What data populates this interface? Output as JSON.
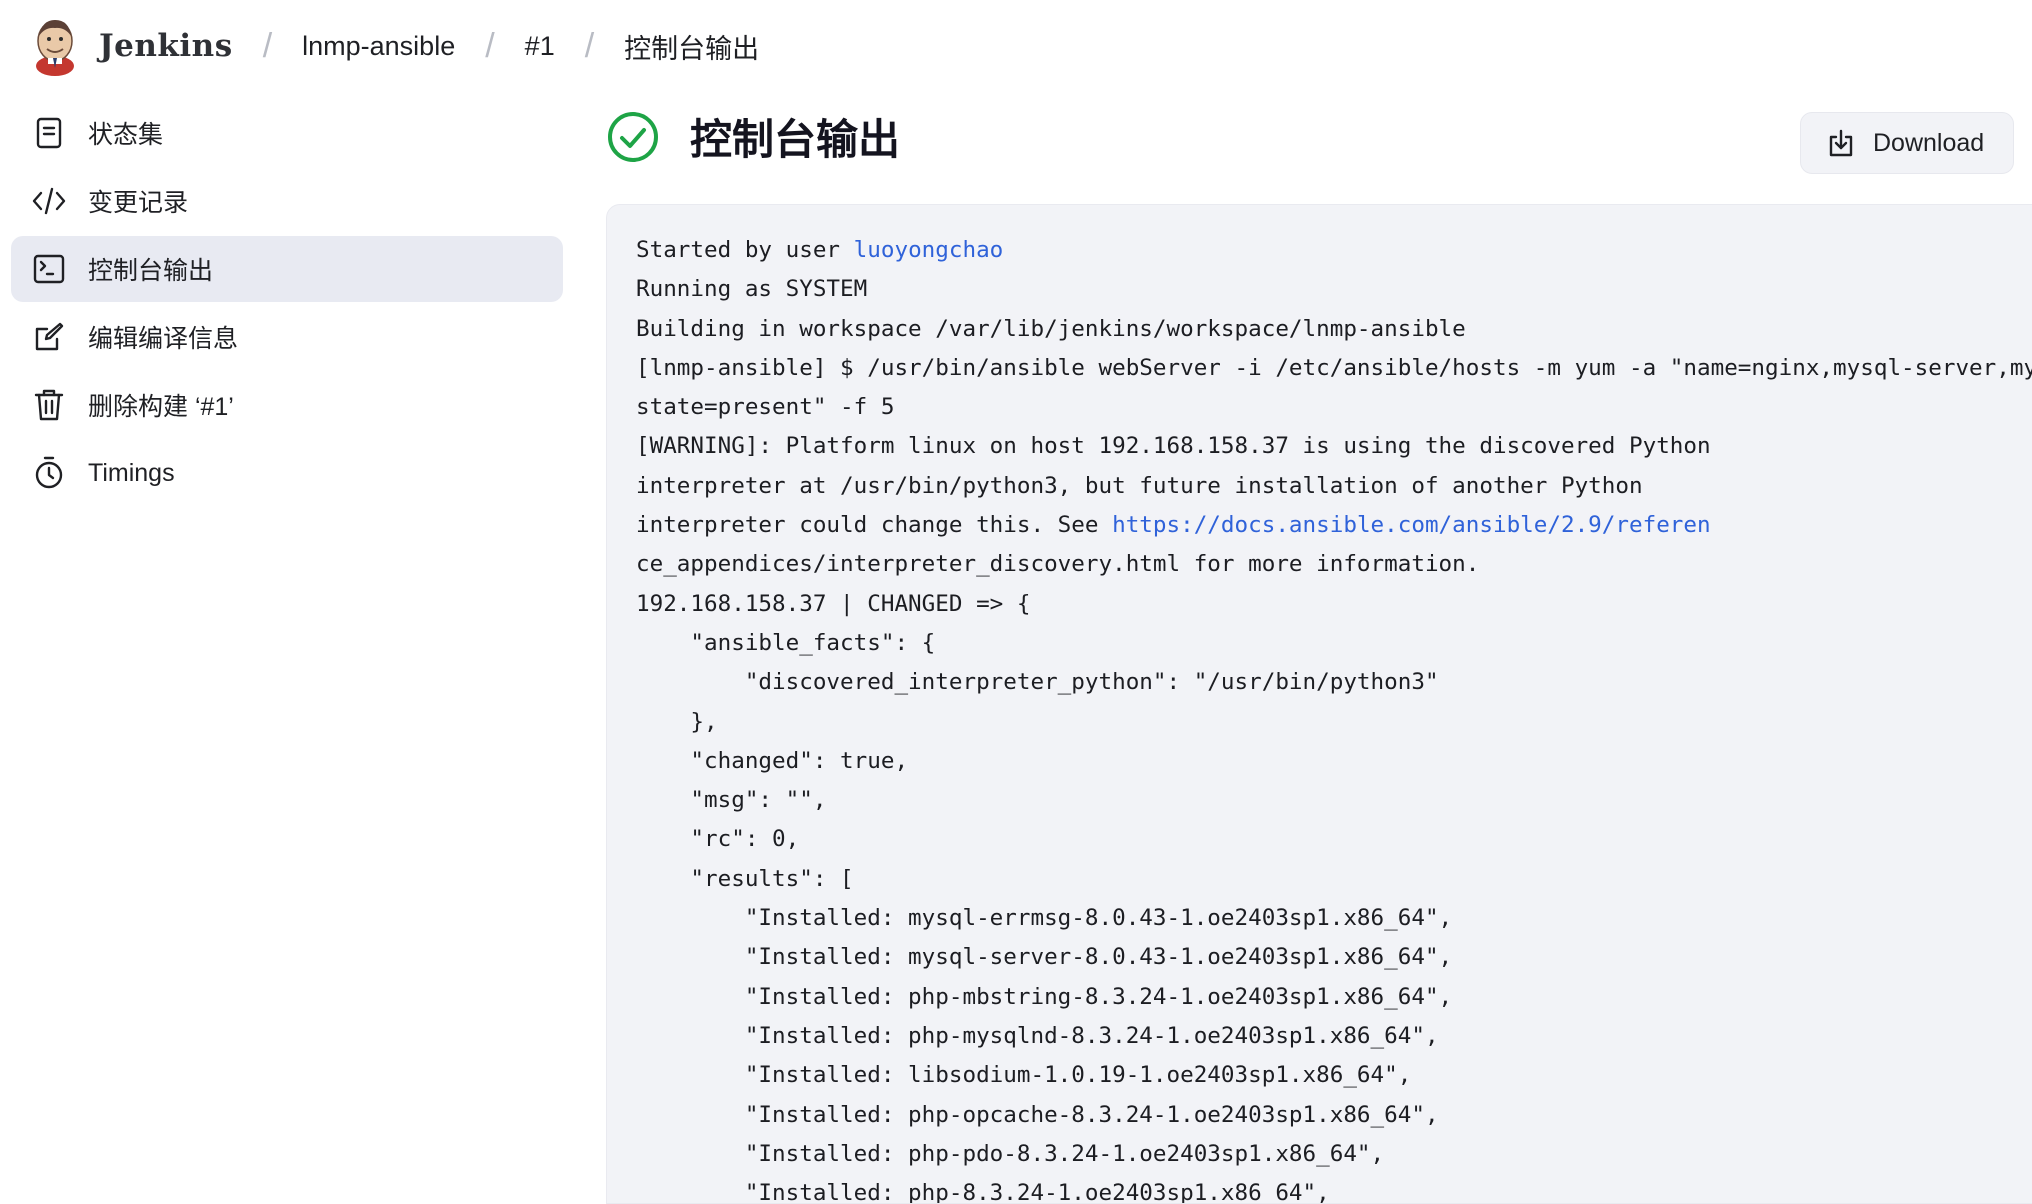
{
  "header": {
    "brand": "Jenkins",
    "breadcrumb": [
      "lnmp-ansible",
      "#1",
      "控制台输出"
    ],
    "separator": "/"
  },
  "sidebar": {
    "items": [
      {
        "label": "状态集",
        "icon": "document-icon"
      },
      {
        "label": "变更记录",
        "icon": "code-icon"
      },
      {
        "label": "控制台输出",
        "icon": "terminal-icon",
        "active": true
      },
      {
        "label": "编辑编译信息",
        "icon": "edit-icon"
      },
      {
        "label": "删除构建 ‘#1’",
        "icon": "trash-icon"
      },
      {
        "label": "Timings",
        "icon": "stopwatch-icon"
      }
    ]
  },
  "main": {
    "title": "控制台输出",
    "status": "success",
    "download_label": "Download"
  },
  "console": {
    "line1_prefix": "Started by user ",
    "user_link": "luoyongchao",
    "line2": "Running as SYSTEM",
    "line3": "Building in workspace /var/lib/jenkins/workspace/lnmp-ansible",
    "line4": "[lnmp-ansible] $ /usr/bin/ansible webServer -i /etc/ansible/hosts -m yum -a \"name=nginx,mysql-server,mysql,",
    "line5": "state=present\" -f 5",
    "line6": "[WARNING]: Platform linux on host 192.168.158.37 is using the discovered Python",
    "line7": "interpreter at /usr/bin/python3, but future installation of another Python",
    "line8_prefix": "interpreter could change this. See ",
    "docs_link": "https://docs.ansible.com/ansible/2.9/referen",
    "line9": "ce_appendices/interpreter_discovery.html for more information.",
    "line10": "192.168.158.37 | CHANGED => {",
    "line11": "    \"ansible_facts\": {",
    "line12": "        \"discovered_interpreter_python\": \"/usr/bin/python3\"",
    "line13": "    },",
    "line14": "    \"changed\": true,",
    "line15": "    \"msg\": \"\",",
    "line16": "    \"rc\": 0,",
    "line17": "    \"results\": [",
    "line18": "        \"Installed: mysql-errmsg-8.0.43-1.oe2403sp1.x86_64\",",
    "line19": "        \"Installed: mysql-server-8.0.43-1.oe2403sp1.x86_64\",",
    "line20": "        \"Installed: php-mbstring-8.3.24-1.oe2403sp1.x86_64\",",
    "line21": "        \"Installed: php-mysqlnd-8.3.24-1.oe2403sp1.x86_64\",",
    "line22": "        \"Installed: libsodium-1.0.19-1.oe2403sp1.x86_64\",",
    "line23": "        \"Installed: php-opcache-8.3.24-1.oe2403sp1.x86_64\",",
    "line24": "        \"Installed: php-pdo-8.3.24-1.oe2403sp1.x86_64\",",
    "line25": "        \"Installed: php-8.3.24-1.oe2403sp1.x86_64\","
  },
  "colors": {
    "accent_link": "#2f62d9",
    "success": "#1ea446",
    "active_bg": "#e8eaf2",
    "console_bg": "#f2f3f7"
  }
}
